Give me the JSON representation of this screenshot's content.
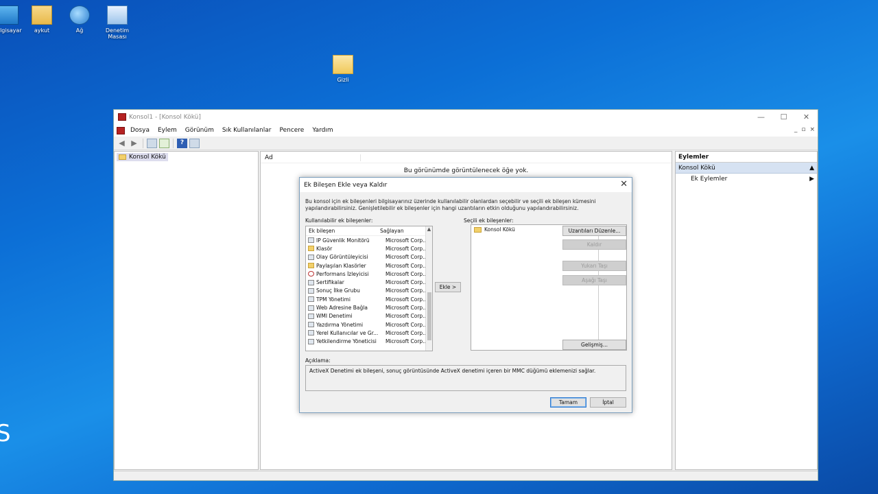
{
  "desktop": {
    "icons": [
      {
        "label": "Bilgisayar"
      },
      {
        "label": "aykut"
      },
      {
        "label": "Ağ"
      },
      {
        "label": "Denetim Masası"
      },
      {
        "label": "Gizli"
      }
    ],
    "left_letter": "S"
  },
  "window": {
    "title": "Konsol1 - [Konsol Kökü]",
    "controls": {
      "minimize": "—",
      "maximize": "☐",
      "close": "✕"
    },
    "inner_controls": {
      "minimize": "_",
      "restore": "▫",
      "close": "×"
    },
    "menu": [
      "Dosya",
      "Eylem",
      "Görünüm",
      "Sık Kullanılanlar",
      "Pencere",
      "Yardım"
    ],
    "tree_root": "Konsol Kökü",
    "main_header": "Ad",
    "main_empty": "Bu görünümde görüntülenecek öğe yok.",
    "actions": {
      "title": "Eylemler",
      "section": "Konsol Kökü",
      "item": "Ek Eylemler"
    }
  },
  "dialog": {
    "title": "Ek Bileşen Ekle veya Kaldır",
    "intro": "Bu konsol için ek bileşenleri bilgisayarınız üzerinde kullanılabilir olanlardan seçebilir ve seçili ek bileşen kümesini yapılandırabilirsiniz. Genişletilebilir ek bileşenler için hangi uzantıların etkin olduğunu yapılandırabilirsiniz.",
    "available_label": "Kullanılabilir ek bileşenler:",
    "selected_label": "Seçili ek bileşenler:",
    "columns": [
      "Ek bileşen",
      "Sağlayan"
    ],
    "rows": [
      [
        "IP Güvenlik Monitörü",
        "Microsoft Corp..."
      ],
      [
        "Klasör",
        "Microsoft Corp..."
      ],
      [
        "Olay Görüntüleyicisi",
        "Microsoft Corp..."
      ],
      [
        "Paylaşılan Klasörler",
        "Microsoft Corp..."
      ],
      [
        "Performans İzleyicisi",
        "Microsoft Corp..."
      ],
      [
        "Sertifikalar",
        "Microsoft Corp..."
      ],
      [
        "Sonuç İlke Grubu",
        "Microsoft Corp..."
      ],
      [
        "TPM Yönetimi",
        "Microsoft Corp..."
      ],
      [
        "Web Adresine Bağla",
        "Microsoft Corp..."
      ],
      [
        "WMI Denetimi",
        "Microsoft Corp..."
      ],
      [
        "Yazdırma Yönetimi",
        "Microsoft Corp..."
      ],
      [
        "Yerel Kullanıcılar ve Gr...",
        "Microsoft Corp..."
      ],
      [
        "Yetkilendirme Yöneticisi",
        "Microsoft Corp..."
      ]
    ],
    "add_button": "Ekle >",
    "selected_item": "Konsol Kökü",
    "buttons": {
      "edit_extensions": "Uzantıları Düzenle...",
      "remove": "Kaldır",
      "move_up": "Yukarı Taşı",
      "move_down": "Aşağı Taşı",
      "advanced": "Gelişmiş...",
      "ok": "Tamam",
      "cancel": "İptal"
    },
    "description_label": "Açıklama:",
    "description": "ActiveX Denetimi ek bileşeni, sonuç görüntüsünde ActiveX denetimi içeren bir MMC düğümü eklemenizi sağlar."
  }
}
